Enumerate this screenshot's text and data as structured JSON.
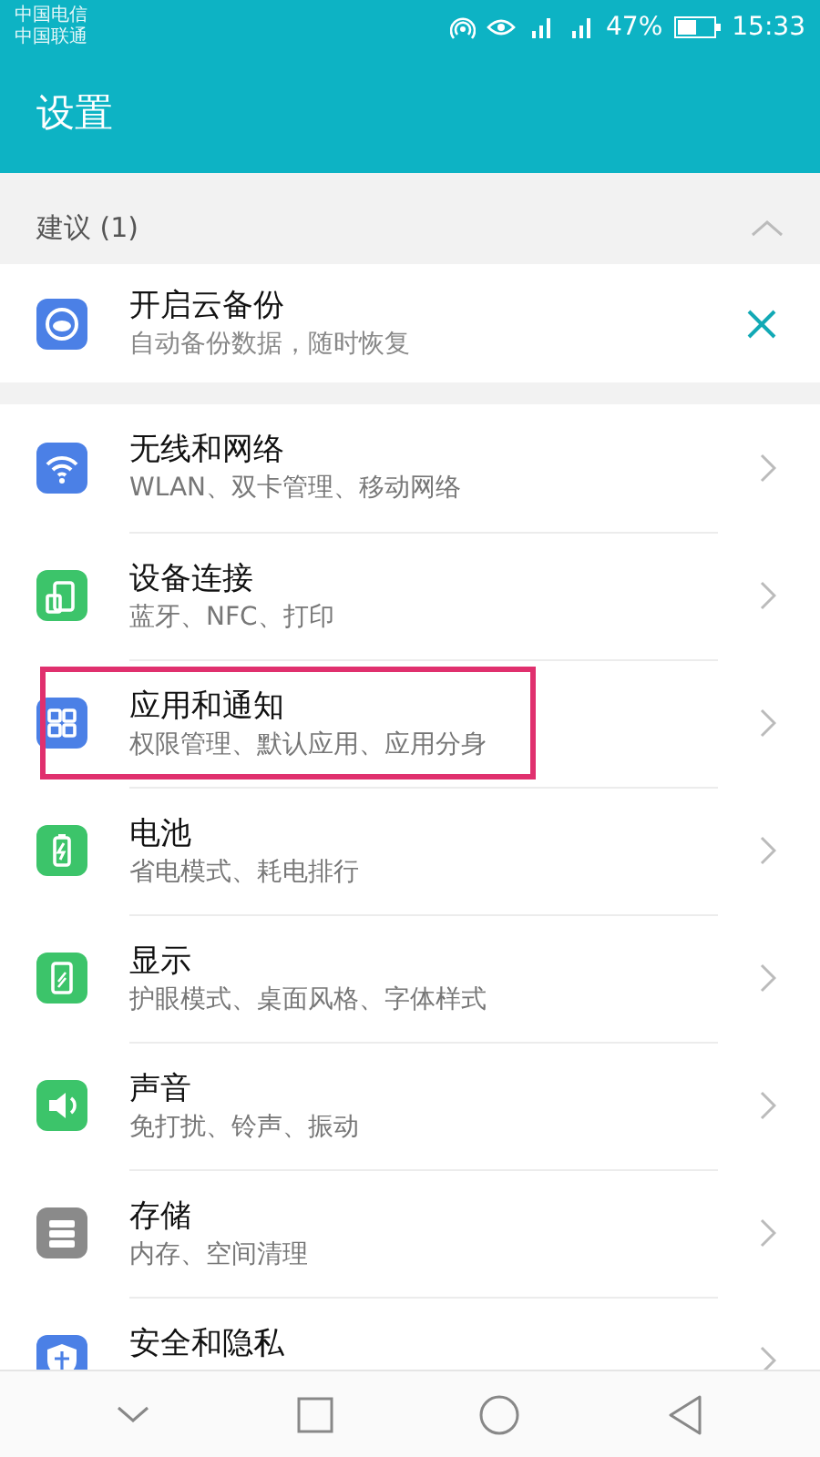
{
  "status_bar": {
    "carriers": [
      "中国电信",
      "中国联通"
    ],
    "battery_percent": "47%",
    "time": "15:33"
  },
  "header": {
    "title": "设置"
  },
  "suggestions": {
    "title": "建议 (1)",
    "expanded": true,
    "items": [
      {
        "title": "开启云备份",
        "subtitle": "自动备份数据，随时恢复",
        "kind": "cloud"
      }
    ]
  },
  "settings": [
    {
      "title": "无线和网络",
      "subtitle": "WLAN、双卡管理、移动网络",
      "kind": "wifi",
      "color": "#4b80e6",
      "highlighted": false
    },
    {
      "title": "设备连接",
      "subtitle": "蓝牙、NFC、打印",
      "kind": "device",
      "color": "#3cc46a",
      "highlighted": false
    },
    {
      "title": "应用和通知",
      "subtitle": "权限管理、默认应用、应用分身",
      "kind": "apps",
      "color": "#4b80e6",
      "highlighted": true
    },
    {
      "title": "电池",
      "subtitle": "省电模式、耗电排行",
      "kind": "battery",
      "color": "#3cc46a",
      "highlighted": false
    },
    {
      "title": "显示",
      "subtitle": "护眼模式、桌面风格、字体样式",
      "kind": "display",
      "color": "#3cc46a",
      "highlighted": false
    },
    {
      "title": "声音",
      "subtitle": "免打扰、铃声、振动",
      "kind": "sound",
      "color": "#3cc46a",
      "highlighted": false
    },
    {
      "title": "存储",
      "subtitle": "内存、空间清理",
      "kind": "storage",
      "color": "#8a8a8a",
      "highlighted": false
    },
    {
      "title": "安全和隐私",
      "kind": "shield",
      "color": "#4b80e6",
      "highlighted": false
    }
  ]
}
